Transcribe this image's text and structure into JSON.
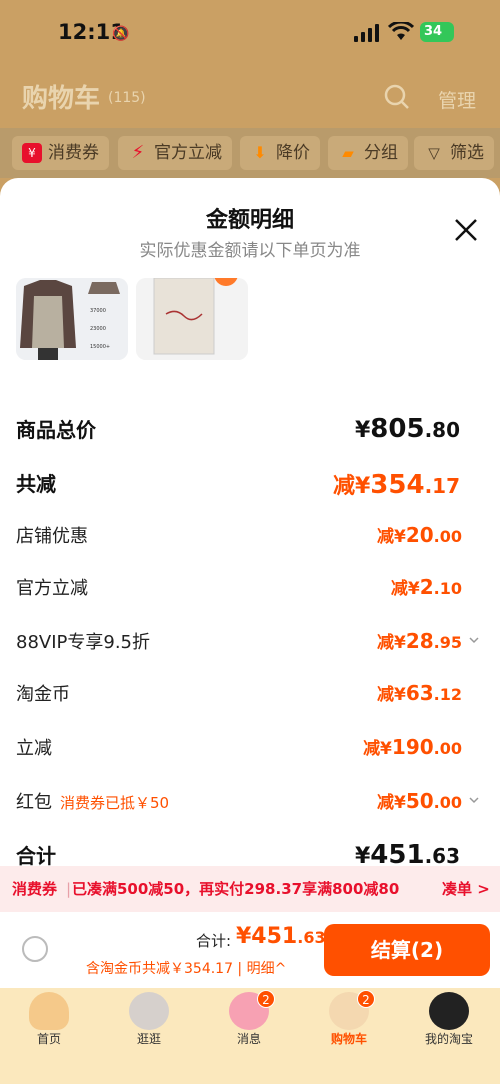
{
  "status": {
    "time": "12:11",
    "battery": "34"
  },
  "header": {
    "title": "购物车",
    "count": "(115)",
    "manage": "管理"
  },
  "chips": [
    {
      "label": "消费券",
      "icon": "coupon-icon",
      "color": "#e8102c"
    },
    {
      "label": "官方立减",
      "icon": "lightning-icon",
      "color": "#e8102c"
    },
    {
      "label": "降价",
      "icon": "price-down-icon",
      "color": "#ff8a00"
    },
    {
      "label": "分组",
      "icon": "folder-icon",
      "color": "#ff8a00"
    },
    {
      "label": "筛选",
      "icon": "filter-icon",
      "color": "#4a3a25"
    }
  ],
  "sheet": {
    "title": "金额明细",
    "subtitle": "实际优惠金额请以下单页为准",
    "thumbs": [
      {
        "tags": [
          "37000",
          "23000",
          "15000+"
        ]
      },
      {
        "tags": []
      }
    ],
    "rows": [
      {
        "label": "商品总价",
        "prefix": "¥",
        "int": "805",
        "dec": ".80",
        "big": true,
        "color": "#111"
      },
      {
        "label": "共减",
        "prefix": "减¥",
        "int": "354",
        "dec": ".17",
        "big": true,
        "color": "#ff5000"
      },
      {
        "label": "店铺优惠",
        "prefix": "减¥",
        "int": "20",
        "dec": ".00",
        "color": "#ff5000"
      },
      {
        "label": "官方立减",
        "prefix": "减¥",
        "int": "2",
        "dec": ".10",
        "color": "#ff5000"
      },
      {
        "label": "88VIP专享9.5折",
        "prefix": "减¥",
        "int": "28",
        "dec": ".95",
        "color": "#ff5000",
        "chev": true
      },
      {
        "label": "淘金币",
        "prefix": "减¥",
        "int": "63",
        "dec": ".12",
        "color": "#ff5000"
      },
      {
        "label": "立减",
        "prefix": "减¥",
        "int": "190",
        "dec": ".00",
        "color": "#ff5000"
      },
      {
        "label": "红包",
        "note": "消费券已抵￥50",
        "prefix": "减¥",
        "int": "50",
        "dec": ".00",
        "color": "#ff5000",
        "chev": true
      },
      {
        "label": "合计",
        "prefix": "¥",
        "int": "451",
        "dec": ".63",
        "big": true,
        "color": "#111"
      }
    ]
  },
  "promo": {
    "tag": "消费券",
    "text": "已凑满500减50，再实付298.37享满800减80",
    "action": "凑单 >"
  },
  "checkout": {
    "total_label": "合计:",
    "total_int": "¥451",
    "total_dec": ".63",
    "sub": "含淘金币共减￥354.17 | 明细^",
    "pay_label": "结算(2)"
  },
  "tabs": [
    {
      "label": "首页",
      "badge": "",
      "active": false
    },
    {
      "label": "逛逛",
      "badge": "",
      "active": false
    },
    {
      "label": "消息",
      "badge": "2",
      "active": false
    },
    {
      "label": "购物车",
      "badge": "2",
      "active": true
    },
    {
      "label": "我的淘宝",
      "badge": "",
      "active": false
    }
  ]
}
